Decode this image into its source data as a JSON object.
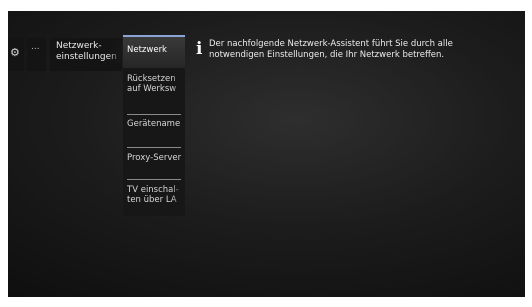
{
  "icons": {
    "settings": "gear-icon",
    "more": "ellipsis-icon",
    "info": "info-icon"
  },
  "menu": {
    "more_label": "...",
    "network_settings": [
      "Netzwerk-",
      "einstellungen"
    ],
    "active_color": "#8aa4d6"
  },
  "submenu": {
    "items": [
      {
        "lines": [
          "Netzwerk"
        ]
      },
      {
        "lines": [
          "Rücksetzen",
          "auf Werksw"
        ]
      },
      {
        "lines": [
          "Gerätename"
        ]
      },
      {
        "lines": [
          "Proxy-Server"
        ]
      },
      {
        "lines": [
          "TV einschal-",
          "ten über LA"
        ]
      }
    ]
  },
  "info": {
    "icon_glyph": "i",
    "lines": [
      "Der nachfolgende Netzwerk-Assistent führt Sie durch alle",
      "notwendigen Einstellungen, die Ihr Netzwerk betreffen."
    ]
  }
}
